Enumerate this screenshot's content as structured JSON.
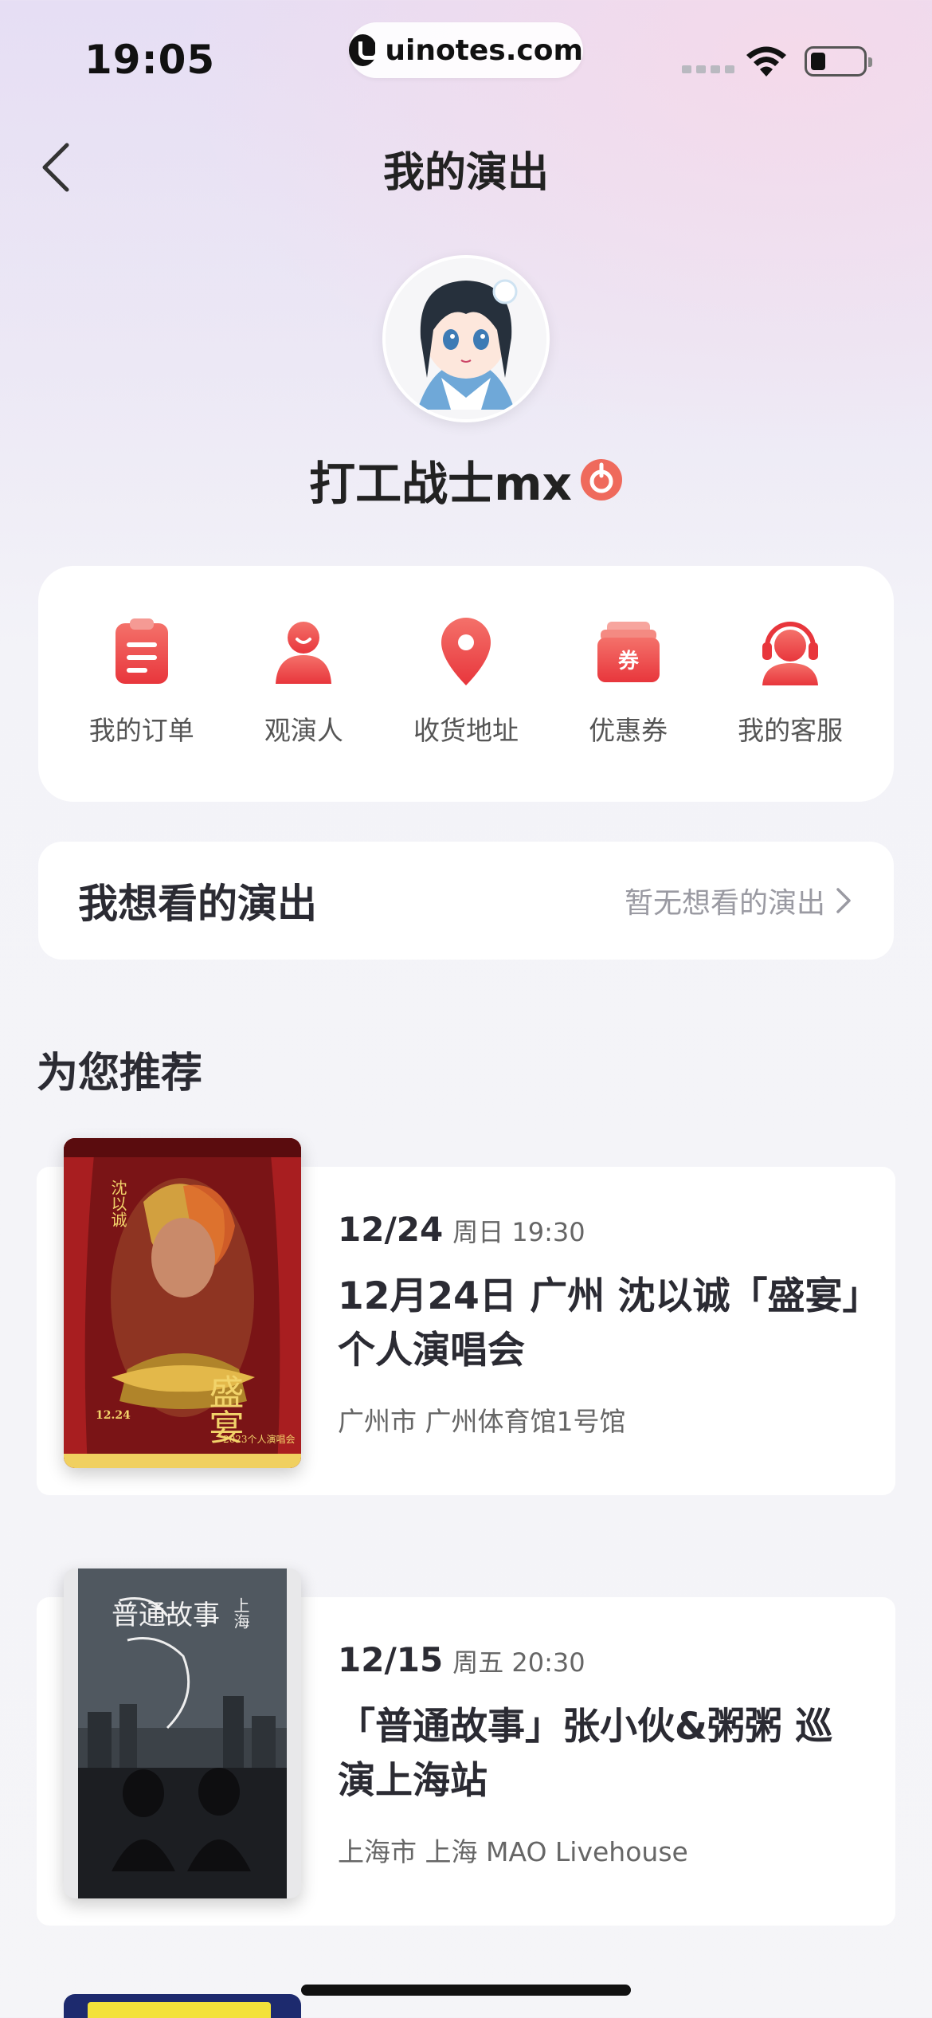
{
  "status_bar": {
    "time": "19:05",
    "url": "uinotes.com"
  },
  "nav": {
    "title": "我的演出",
    "back_icon": "chevron-left-icon"
  },
  "profile": {
    "username": "打工战士mx",
    "badge_icon": "vip-badge-icon",
    "avatar_icon": "anime-avatar"
  },
  "quick_actions": [
    {
      "label": "我的订单",
      "icon": "order-clipboard-icon"
    },
    {
      "label": "观演人",
      "icon": "person-icon"
    },
    {
      "label": "收货地址",
      "icon": "location-pin-icon"
    },
    {
      "label": "优惠券",
      "icon": "coupon-icon",
      "icon_text": "券"
    },
    {
      "label": "我的客服",
      "icon": "customer-service-icon"
    }
  ],
  "wishlist": {
    "title": "我想看的演出",
    "empty_text": "暂无想看的演出"
  },
  "recommend": {
    "section_title": "为您推荐",
    "shows": [
      {
        "date": "12/24",
        "weekday_time": "周日 19:30",
        "title": "12月24日 广州 沈以诚「盛宴」个人演唱会",
        "venue": "广州市 广州体育馆1号馆",
        "poster": {
          "artist": "沈以诚",
          "name": "盛宴",
          "subtitle": "2023个人演唱会",
          "date": "12.24"
        }
      },
      {
        "date": "12/15",
        "weekday_time": "周五 20:30",
        "title": "「普通故事」张小伙&粥粥 巡演上海站",
        "venue": "上海市 上海 MAO Livehouse",
        "poster": {
          "name": "普通故事",
          "city": "上海"
        }
      }
    ]
  },
  "colors": {
    "accent": "#ef4b4b",
    "title_text": "#2b2b33"
  }
}
